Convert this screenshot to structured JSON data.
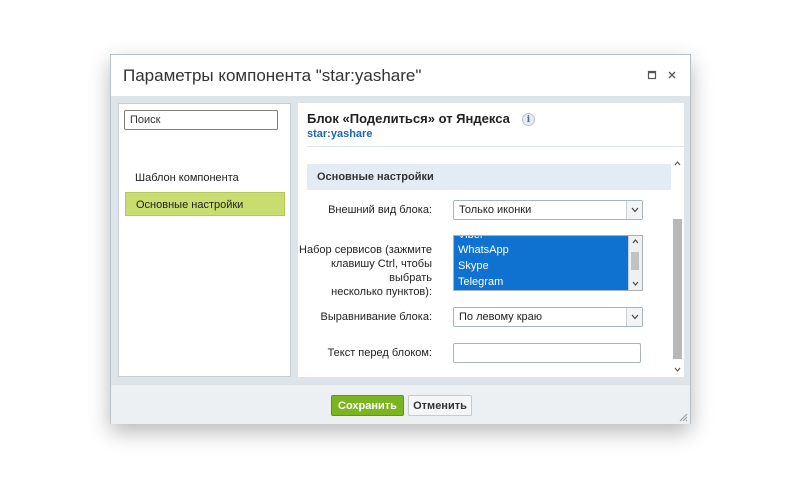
{
  "dialog": {
    "title": "Параметры компонента \"star:yashare\"",
    "icons": {
      "maximize": "maximize-icon",
      "close": "close-icon"
    }
  },
  "sidebar": {
    "search_placeholder": "Поиск",
    "items": [
      {
        "label": "Шаблон компонента",
        "active": false
      },
      {
        "label": "Основные настройки",
        "active": true
      }
    ]
  },
  "component": {
    "title": "Блок «Поделиться» от Яндекса",
    "code": "star:yashare",
    "info_icon": "i"
  },
  "section": {
    "title": "Основные настройки"
  },
  "fields": {
    "appearance": {
      "label": "Внешний вид блока:",
      "value": "Только иконки"
    },
    "services": {
      "label_lines": [
        "Набор сервисов (зажмите",
        "клавишу Ctrl, чтобы выбрать",
        "несколько пунктов):"
      ],
      "options": [
        "Viber",
        "WhatsApp",
        "Skype",
        "Telegram"
      ]
    },
    "alignment": {
      "label": "Выравнивание блока:",
      "value": "По левому краю"
    },
    "text_before": {
      "label": "Текст перед блоком:",
      "value": ""
    }
  },
  "footer": {
    "save_label": "Сохранить",
    "cancel_label": "Отменить"
  },
  "colors": {
    "accent_green": "#7ab520",
    "active_nav": "#c8dc70",
    "selection_blue": "#0f72d1",
    "link_blue": "#2067b0"
  }
}
